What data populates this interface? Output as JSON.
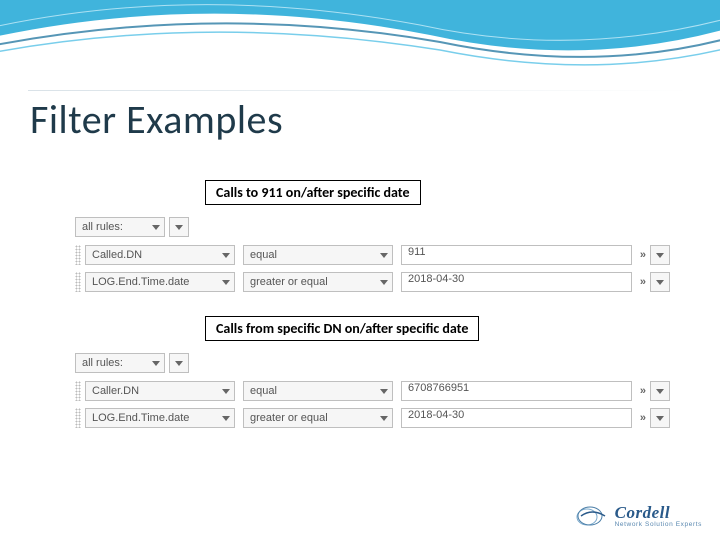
{
  "title": "Filter Examples",
  "captions": {
    "first": "Calls to 911 on/after specific date",
    "second": "Calls from specific DN on/after specific date"
  },
  "groupA": {
    "mode": "all rules:",
    "rules": [
      {
        "field": "Called.DN",
        "op": "equal",
        "value": "911"
      },
      {
        "field": "LOG.End.Time.date",
        "op": "greater or equal",
        "value": "2018-04-30"
      }
    ]
  },
  "groupB": {
    "mode": "all rules:",
    "rules": [
      {
        "field": "Caller.DN",
        "op": "equal",
        "value": "6708766951"
      },
      {
        "field": "LOG.End.Time.date",
        "op": "greater or equal",
        "value": "2018-04-30"
      }
    ]
  },
  "brand": {
    "name": "Cordell",
    "tagline": "Network Solution Experts"
  }
}
